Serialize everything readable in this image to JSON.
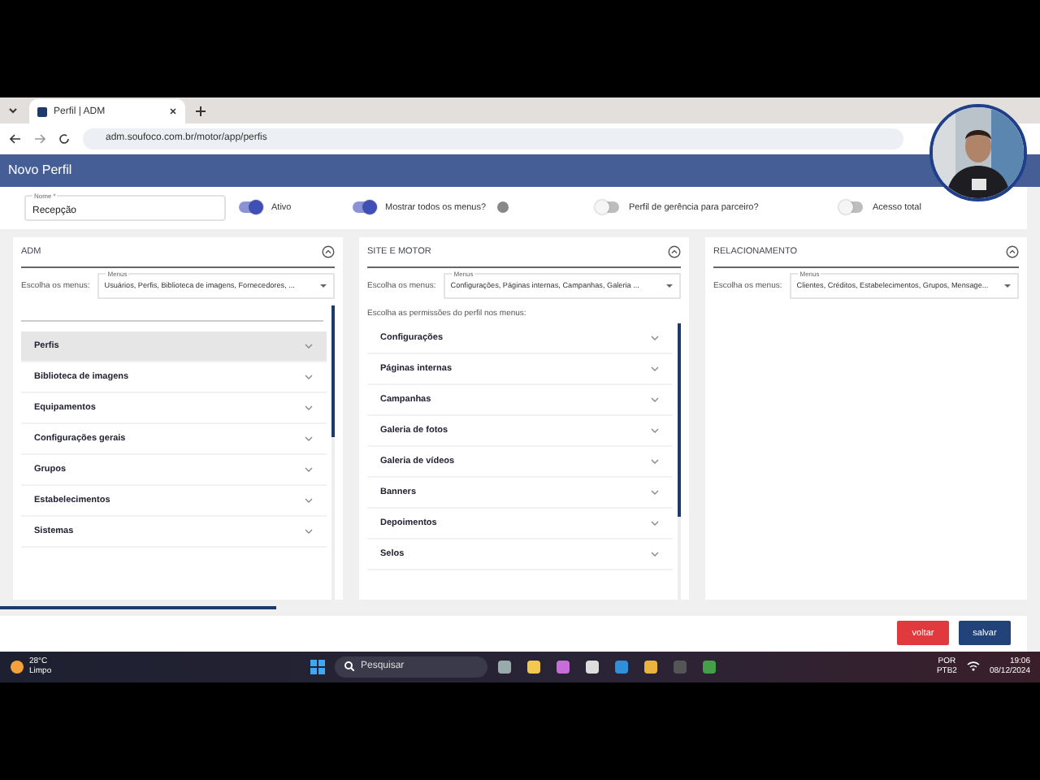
{
  "browser": {
    "tab_title": "Perfil | ADM",
    "url": "adm.soufoco.com.br/motor/app/perfis"
  },
  "page": {
    "title": "Novo Perfil",
    "name_field": {
      "label": "Nome *",
      "value": "Recepção"
    },
    "toggles": [
      {
        "label": "Ativo",
        "on": true
      },
      {
        "label": "Mostrar todos os menus?",
        "on": true,
        "info": true
      },
      {
        "label": "Perfil de gerência para parceiro?",
        "on": false
      },
      {
        "label": "Acesso total",
        "on": false
      }
    ],
    "panels": [
      {
        "title": "ADM",
        "menus_label": "Escolha os menus:",
        "select_label": "Menus",
        "select_value": "Usuários, Perfis, Biblioteca de imagens, Fornecedores, ...",
        "search": true,
        "items": [
          {
            "label": "Perfis",
            "hovered": true
          },
          {
            "label": "Biblioteca de imagens",
            "hovered": false
          },
          {
            "label": "Equipamentos",
            "hovered": false
          },
          {
            "label": "Configurações gerais",
            "hovered": false
          },
          {
            "label": "Grupos",
            "hovered": false
          },
          {
            "label": "Estabelecimentos",
            "hovered": false
          },
          {
            "label": "Sistemas",
            "hovered": false
          }
        ]
      },
      {
        "title": "SITE E MOTOR",
        "menus_label": "Escolha os menus:",
        "select_label": "Menus",
        "select_value": "Configurações, Páginas internas, Campanhas, Galeria ...",
        "hint": "Escolha as permissões do perfil nos menus:",
        "items": [
          {
            "label": "Configurações",
            "hovered": false
          },
          {
            "label": "Páginas internas",
            "hovered": false
          },
          {
            "label": "Campanhas",
            "hovered": false
          },
          {
            "label": "Galeria de fotos",
            "hovered": false
          },
          {
            "label": "Galeria de vídeos",
            "hovered": false
          },
          {
            "label": "Banners",
            "hovered": false
          },
          {
            "label": "Depoimentos",
            "hovered": false
          },
          {
            "label": "Selos",
            "hovered": false
          }
        ]
      },
      {
        "title": "RELACIONAMENTO",
        "menus_label": "Escolha os menus:",
        "select_label": "Menus",
        "select_value": "Clientes, Créditos, Estabelecimentos, Grupos, Mensage..."
      }
    ],
    "buttons": [
      {
        "label": "voltar",
        "kind": "back"
      },
      {
        "label": "salvar",
        "kind": "save"
      }
    ]
  },
  "taskbar": {
    "temperature": "28°C",
    "weather": "Limpo",
    "search_placeholder": "Pesquisar",
    "language": "POR",
    "layout": "PTB2",
    "time": "19:06",
    "date": "08/12/2024"
  }
}
